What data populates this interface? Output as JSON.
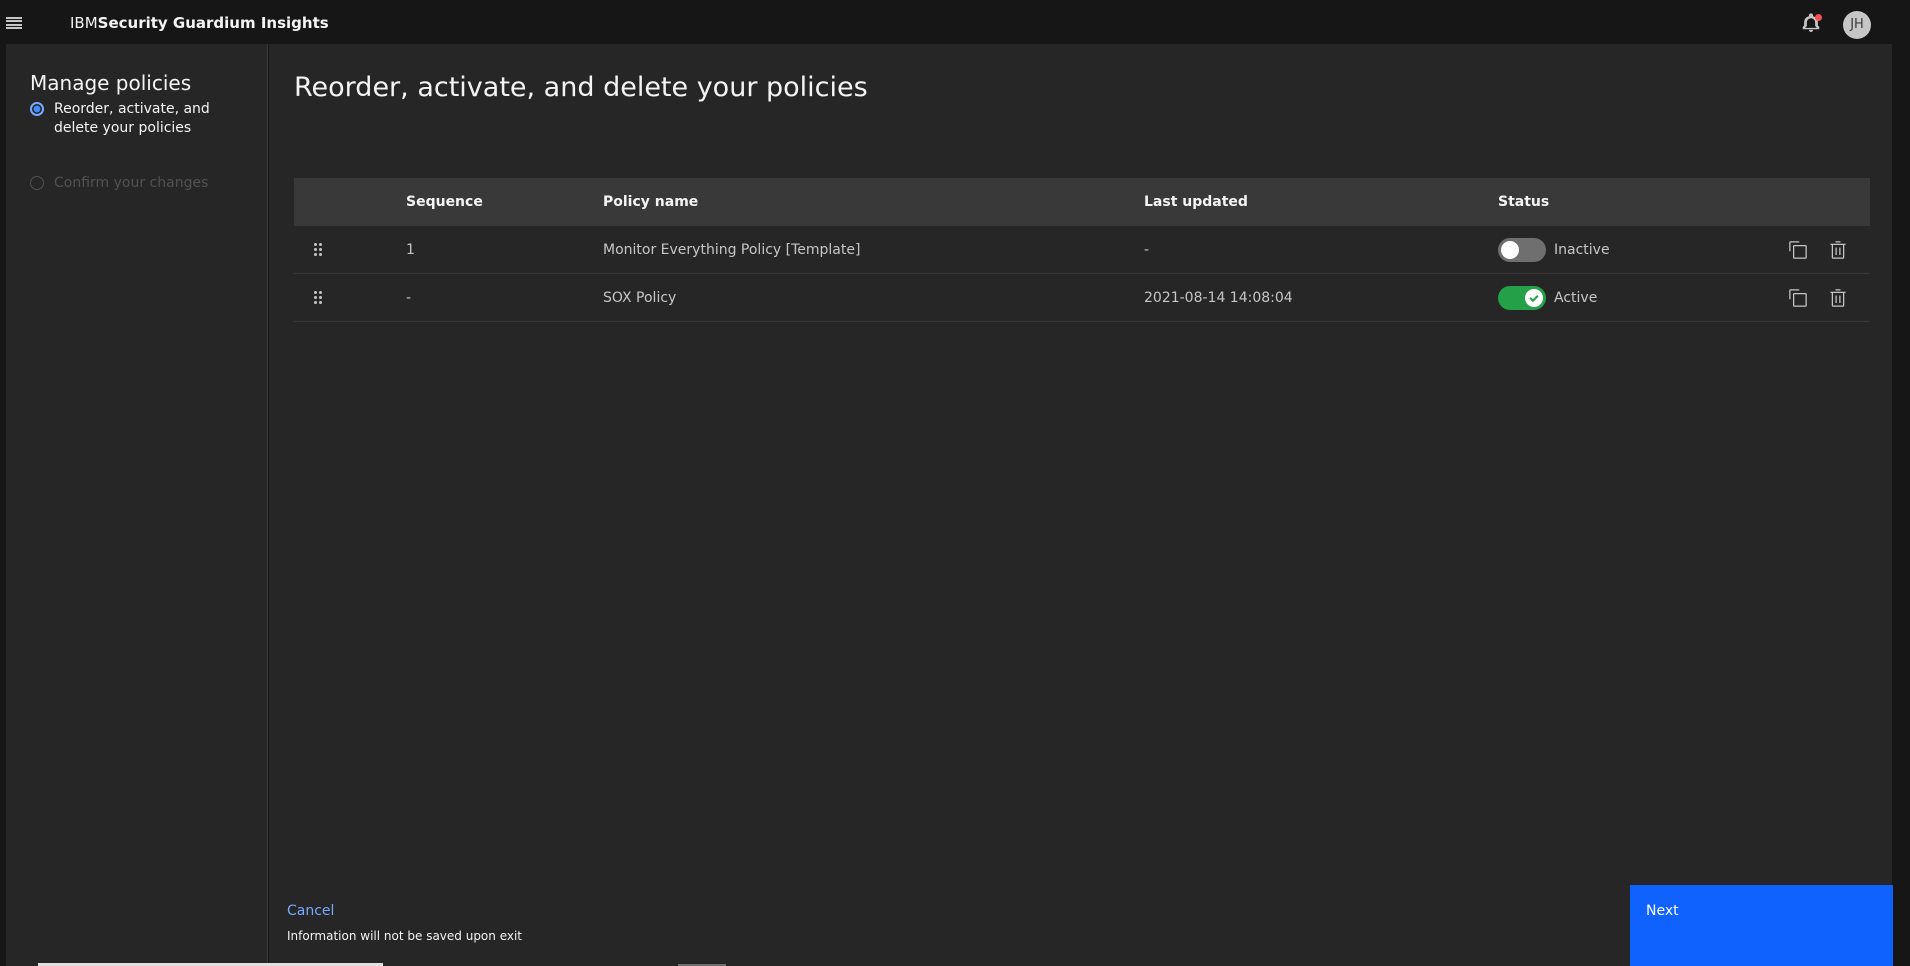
{
  "header": {
    "brand_ibm": "IBM",
    "brand_product": "Security Guardium Insights",
    "user_initials": "JH"
  },
  "side_panel": {
    "title": "Manage policies",
    "steps": [
      {
        "label": "Reorder, activate, and delete your policies",
        "state": "current"
      },
      {
        "label": "Confirm your changes",
        "state": "incomplete"
      }
    ]
  },
  "main": {
    "title": "Reorder, activate, and delete your policies",
    "table": {
      "columns": [
        "Sequence",
        "Policy name",
        "Last updated",
        "Status"
      ],
      "rows": [
        {
          "sequence": "1",
          "policy_name": "Monitor Everything Policy [Template]",
          "last_updated": "-",
          "status": "Inactive",
          "active": false
        },
        {
          "sequence": "-",
          "policy_name": "SOX Policy",
          "last_updated": "2021-08-14 14:08:04",
          "status": "Active",
          "active": true
        }
      ]
    }
  },
  "footer": {
    "cancel_label": "Cancel",
    "note": "Information will not be saved upon exit",
    "next_label": "Next"
  },
  "colors": {
    "accent": "#0f62fe",
    "toggle_on": "#24a148",
    "link": "#78a9ff",
    "notification_dot": "#fa4d56"
  },
  "icons": {
    "menu": "hamburger-menu-icon",
    "notifications": "bell-icon",
    "drag": "drag-handle-icon",
    "copy": "copy-icon",
    "delete": "trash-icon"
  }
}
